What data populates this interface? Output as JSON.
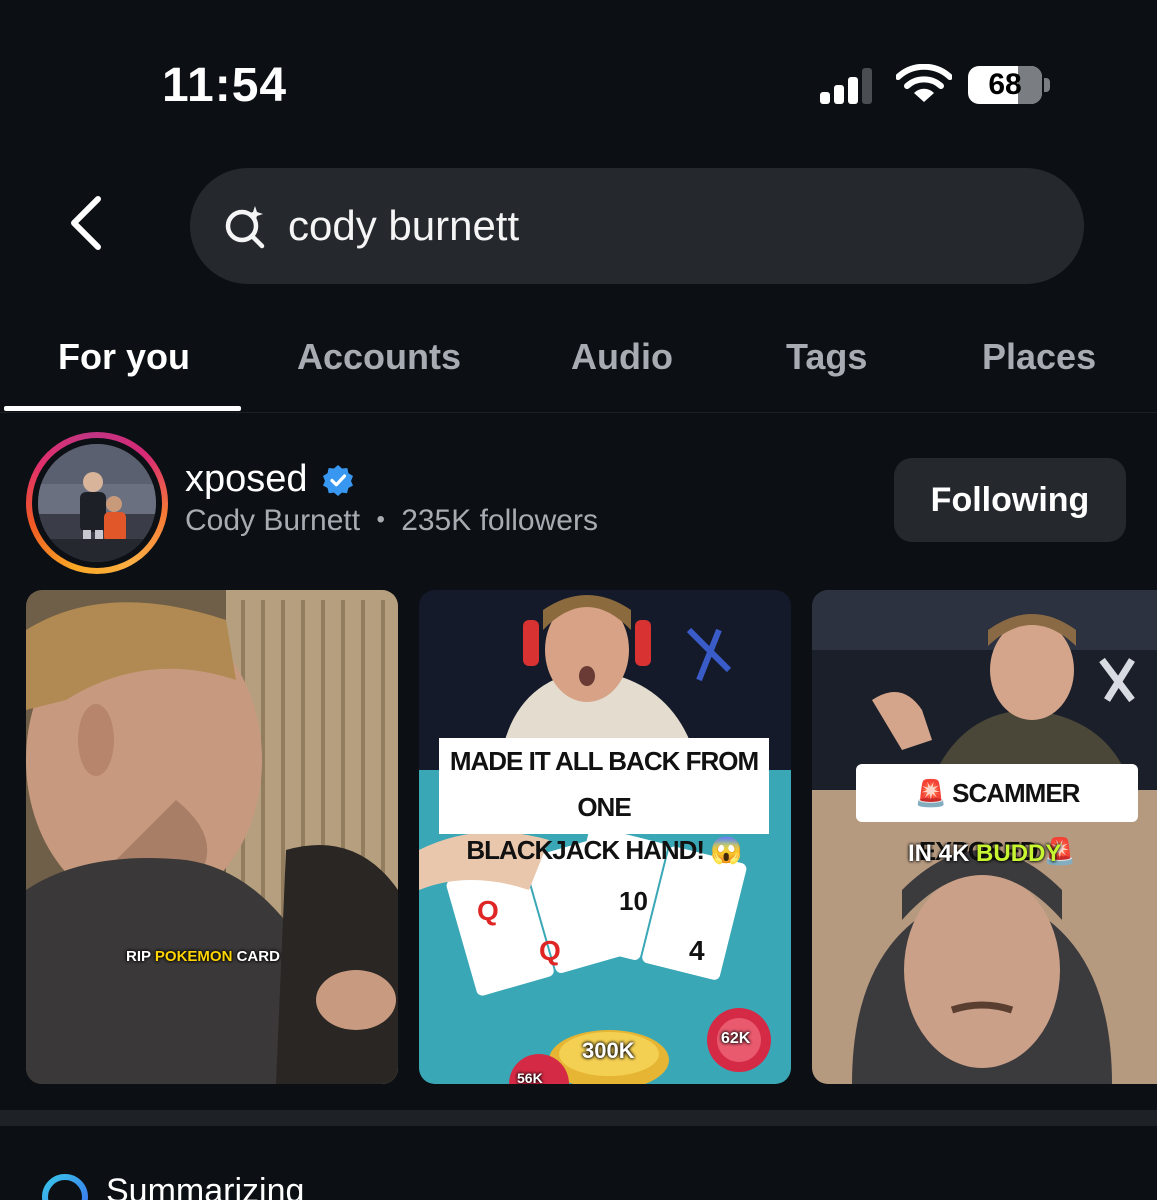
{
  "status_bar": {
    "time": "11:54",
    "battery": "68",
    "battery_level": 0.68
  },
  "search": {
    "query": "cody burnett"
  },
  "tabs": [
    {
      "label": "For you",
      "active": true
    },
    {
      "label": "Accounts",
      "active": false
    },
    {
      "label": "Audio",
      "active": false
    },
    {
      "label": "Tags",
      "active": false
    },
    {
      "label": "Places",
      "active": false
    }
  ],
  "account": {
    "username": "xposed",
    "verified": true,
    "full_name": "Cody Burnett",
    "separator": "•",
    "followers": "235K followers",
    "follow_button": "Following"
  },
  "results": [
    {
      "caption_prefix": "RIP ",
      "caption_highlight": "POKEMON",
      "caption_suffix": " CARD"
    },
    {
      "caption_line1": "MADE IT ALL BACK FROM ONE",
      "caption_line2": "BLACKJACK HAND! 😱",
      "chips": [
        "300K",
        "62K",
        "56K"
      ]
    },
    {
      "caption_main": "SCAMMER EXPOSED",
      "caption_sub_prefix": "IN ",
      "caption_sub_mid": "4K",
      "caption_sub_highlight": "BUDDY"
    }
  ],
  "summary": {
    "label": "Summarizing"
  },
  "colors": {
    "background": "#0c1014",
    "surface": "#25292e",
    "text_primary": "#ffffff",
    "text_secondary": "#a8acb2",
    "verified_blue": "#3897f0"
  }
}
